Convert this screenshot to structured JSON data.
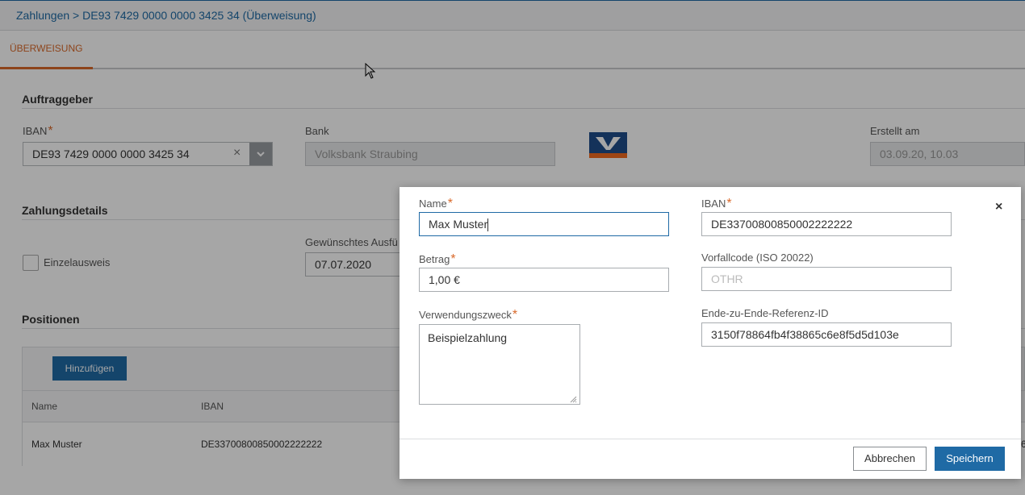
{
  "breadcrumb": "Zahlungen > DE93 7429 0000 0000 3425 34 (Überweisung)",
  "tab": "ÜBERWEISUNG",
  "auftraggeber": {
    "title": "Auftraggeber",
    "iban_label": "IBAN",
    "iban_value": "DE93 7429 0000 0000 3425 34",
    "bank_label": "Bank",
    "bank_value": "Volksbank Straubing",
    "erstellt_label": "Erstellt am",
    "erstellt_value": "03.09.20, 10.03"
  },
  "zahlungsdetails": {
    "title": "Zahlungsdetails",
    "einzelausweis_label": "Einzelausweis",
    "datum_label": "Gewünschtes Ausfü",
    "datum_value": "07.07.2020"
  },
  "positionen": {
    "title": "Positionen",
    "add_button": "Hinzufügen",
    "columns": [
      "Name",
      "IBAN"
    ],
    "rows": [
      {
        "name": "Max Muster",
        "iban": "DE33700800850002222222",
        "tail": "6"
      }
    ]
  },
  "required_mark": "*",
  "modal": {
    "name_label": "Name",
    "name_value": "Max Muster",
    "iban_label": "IBAN",
    "iban_value": "DE33700800850002222222",
    "betrag_label": "Betrag",
    "betrag_value": "1,00 €",
    "vorfallcode_label": "Vorfallcode (ISO 20022)",
    "vorfallcode_placeholder": "OTHR",
    "zweck_label": "Verwendungszweck",
    "zweck_value": "Beispielzahlung",
    "e2e_label": "Ende-zu-Ende-Referenz-ID",
    "e2e_value": "3150f78864fb4f38865c6e8f5d5d103e",
    "close_symbol": "×",
    "cancel_label": "Abbrechen",
    "save_label": "Speichern"
  },
  "colors": {
    "primary": "#1f6aa5",
    "accent": "#d9692a",
    "overlay": "rgba(0,0,0,0.35)"
  },
  "icons": [
    "clear-icon",
    "chevron-down-icon",
    "close-icon",
    "resize-handle-icon",
    "bank-logo",
    "mouse-cursor-icon"
  ]
}
